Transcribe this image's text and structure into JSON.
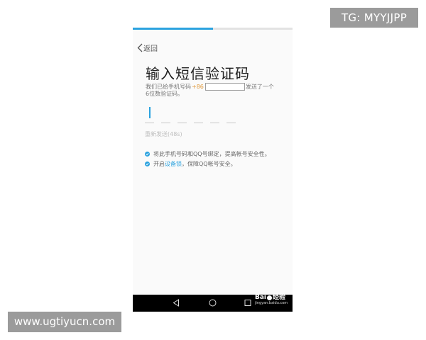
{
  "watermarks": {
    "tg": "TG: MYYJJPP",
    "url": "www.ugtiyucn.com"
  },
  "progress": {
    "fraction": 0.5,
    "color": "#2ba2df"
  },
  "header": {
    "back_label": "返回"
  },
  "main": {
    "title": "输入短信验证码",
    "desc_before_code": "我们已给手机号码",
    "country_code": "+86",
    "desc_after_phone": "发送了一个",
    "desc_line2": "6位数验证码。",
    "resend_label": "重新发送(48s)",
    "digit_count": 6
  },
  "tips": {
    "tip1": "将此手机号码和QQ号绑定，提高帐号安全性。",
    "tip2_before": "开启",
    "tip2_link": "设备锁",
    "tip2_after": "，保障QQ帐号安全。"
  },
  "branding": {
    "baidu_logo_left": "Bai",
    "baidu_logo_right": "经验",
    "baidu_url": "jingyan.baidu.com"
  },
  "colors": {
    "accent": "#2ba2df",
    "code": "#e09a3c"
  }
}
